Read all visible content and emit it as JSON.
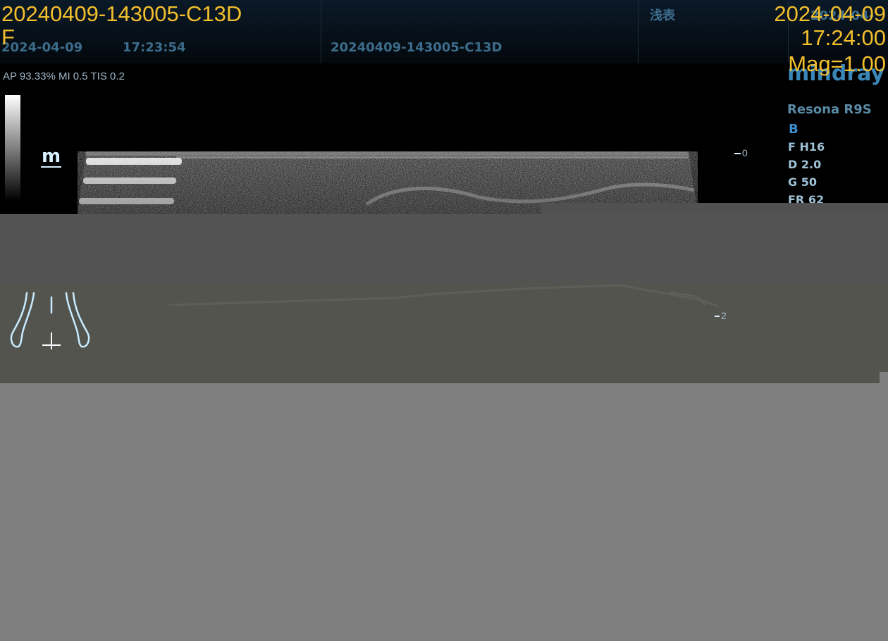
{
  "header": {
    "date": "2024-04-09",
    "time": "17:23:54",
    "study_id": "20240409-143005-C13D",
    "exam_preset": "浅表",
    "date_right": "2024-04-"
  },
  "acoustic_output": "AP 93.33%  MI 0.5 TIS 0.2",
  "orientation_marker": "m",
  "depth_scale": {
    "top_label": "0",
    "bottom_label": "2"
  },
  "system": {
    "brand": "mindray",
    "model": "Resona R9S",
    "mode": "B",
    "params": [
      "F H16",
      "D 2.0",
      "G 50",
      "FR 62"
    ]
  },
  "overlay": {
    "filename": "20240409-143005-C13D",
    "sub": "F",
    "date": "2024-04-09",
    "time": "17:24:00",
    "magnification": "Mag=1.00"
  },
  "colors": {
    "overlay_text": "#f3bf2c",
    "header_text": "#3d6d8c",
    "brand": "#3a86b6",
    "body_mark": "#c8ecff"
  },
  "icons": {
    "body_mark": "lower-body-pictogram-icon",
    "probe_position": "probe-marker-icon"
  }
}
